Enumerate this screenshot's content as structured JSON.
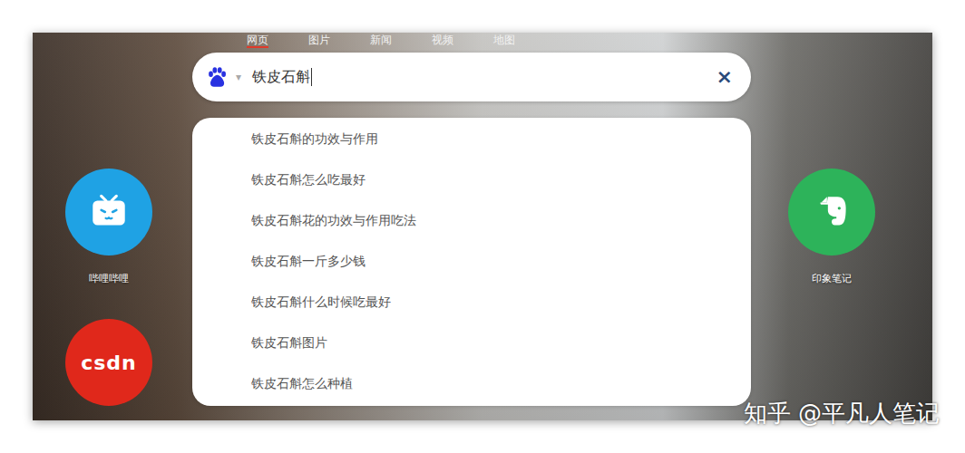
{
  "tabs": [
    {
      "label": "网页",
      "selected": true
    },
    {
      "label": "图片",
      "selected": false
    },
    {
      "label": "新闻",
      "selected": false
    },
    {
      "label": "视频",
      "selected": false
    },
    {
      "label": "地图",
      "selected": false
    }
  ],
  "search": {
    "value": "铁皮石斛",
    "focused": true,
    "dropdown_icon": "▾",
    "clear_icon": "×"
  },
  "suggestions": [
    "铁皮石斛的功效与作用",
    "铁皮石斛怎么吃最好",
    "铁皮石斛花的功效与作用吃法",
    "铁皮石斛一斤多少钱",
    "铁皮石斛什么时候吃最好",
    "铁皮石斛图片",
    "铁皮石斛怎么种植"
  ],
  "left_shortcuts": [
    {
      "kind": "bilibili",
      "label": "哔哩哔哩",
      "logo_text": "",
      "color": "#1fa2e4"
    },
    {
      "kind": "csdn",
      "label": "",
      "logo_text": "csdn",
      "color": "#e0281b"
    }
  ],
  "right_shortcuts": [
    {
      "kind": "evernote",
      "label": "印象笔记",
      "logo_text": "",
      "color": "#2db35a"
    }
  ],
  "watermark": "知乎 @平凡人笔记"
}
